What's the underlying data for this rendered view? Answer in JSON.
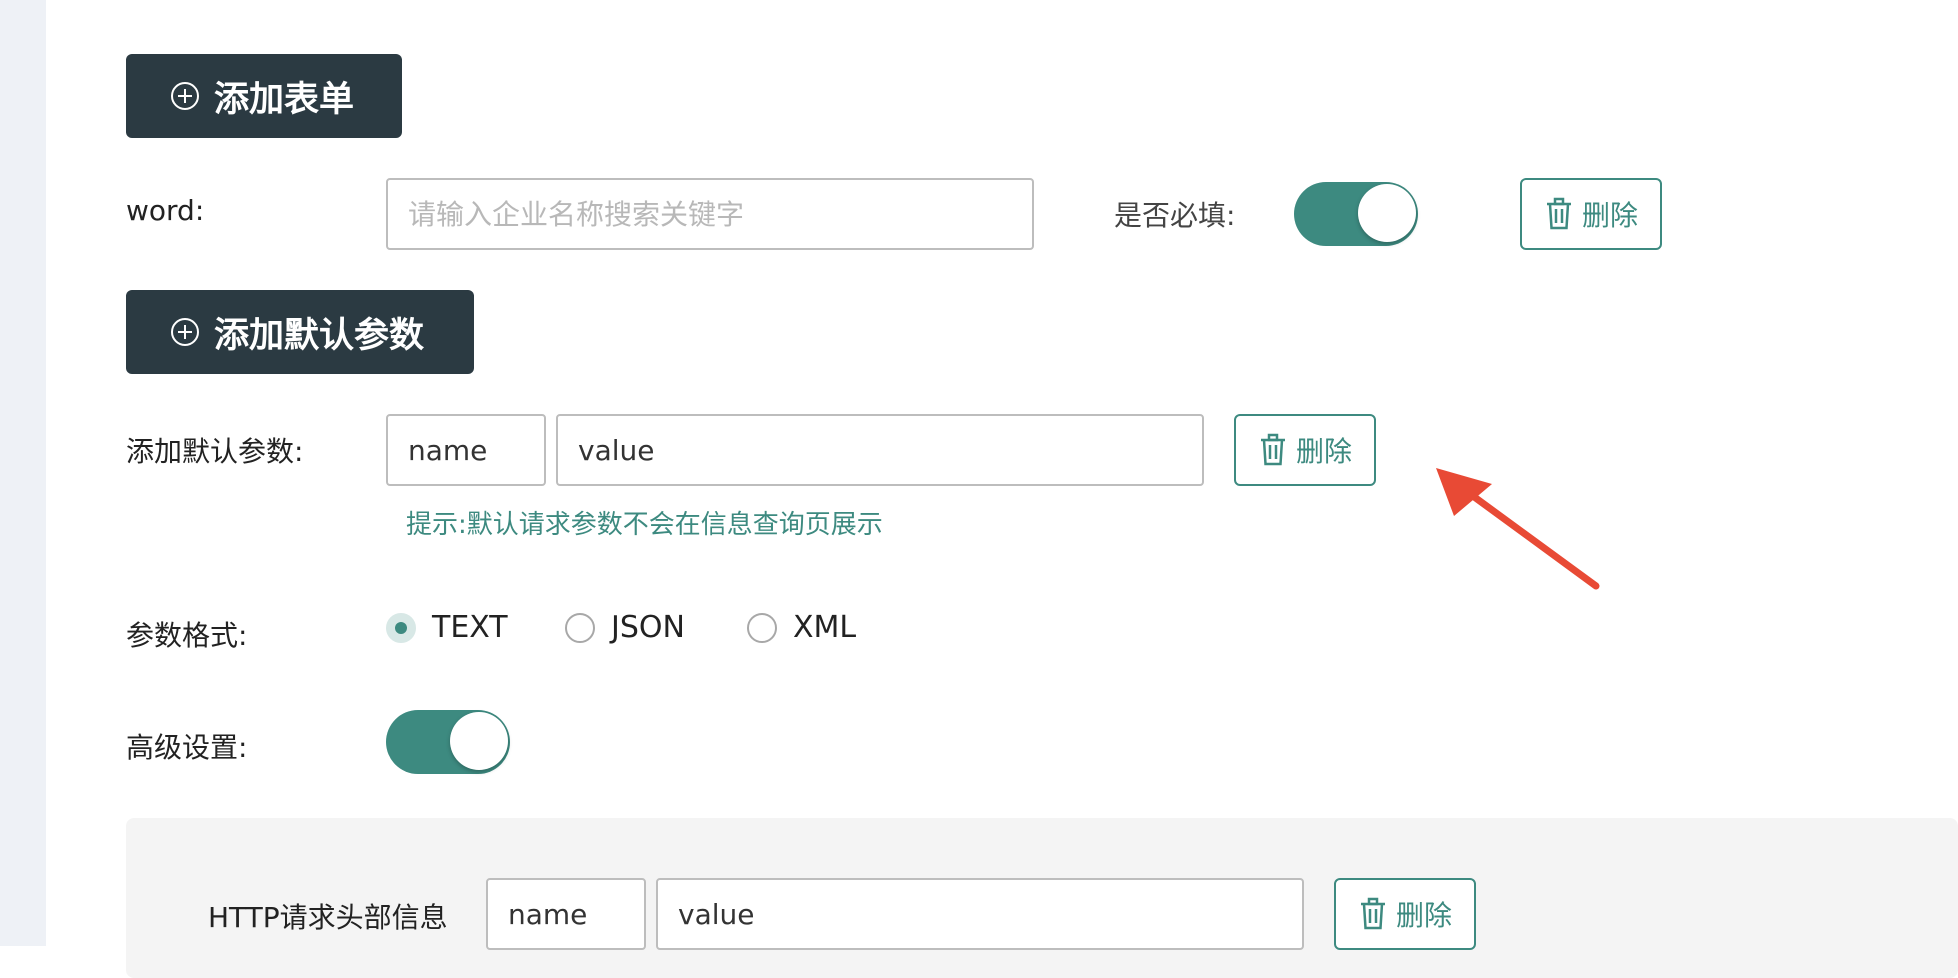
{
  "buttons": {
    "add_form": "添加表单",
    "add_default_param": "添加默认参数",
    "delete": "删除"
  },
  "form_row": {
    "label": "word:",
    "placeholder": "请输入企业名称搜索关键字",
    "required_label": "是否必填:",
    "required_on": true
  },
  "default_param": {
    "label": "添加默认参数:",
    "name_value": "name",
    "value_value": "value",
    "hint": "提示:默认请求参数不会在信息查询页展示"
  },
  "param_format": {
    "label": "参数格式:",
    "options": [
      "TEXT",
      "JSON",
      "XML"
    ],
    "selected": "TEXT"
  },
  "advanced": {
    "label": "高级设置:",
    "enabled": true
  },
  "http_header": {
    "label": "HTTP请求头部信息",
    "name_value": "name",
    "value_value": "value"
  },
  "colors": {
    "accent": "#3d8a80",
    "dark_button": "#2b3a42",
    "arrow": "#e84a35"
  },
  "icons": [
    "plus-circle-icon",
    "trash-icon",
    "annotation-arrow"
  ]
}
